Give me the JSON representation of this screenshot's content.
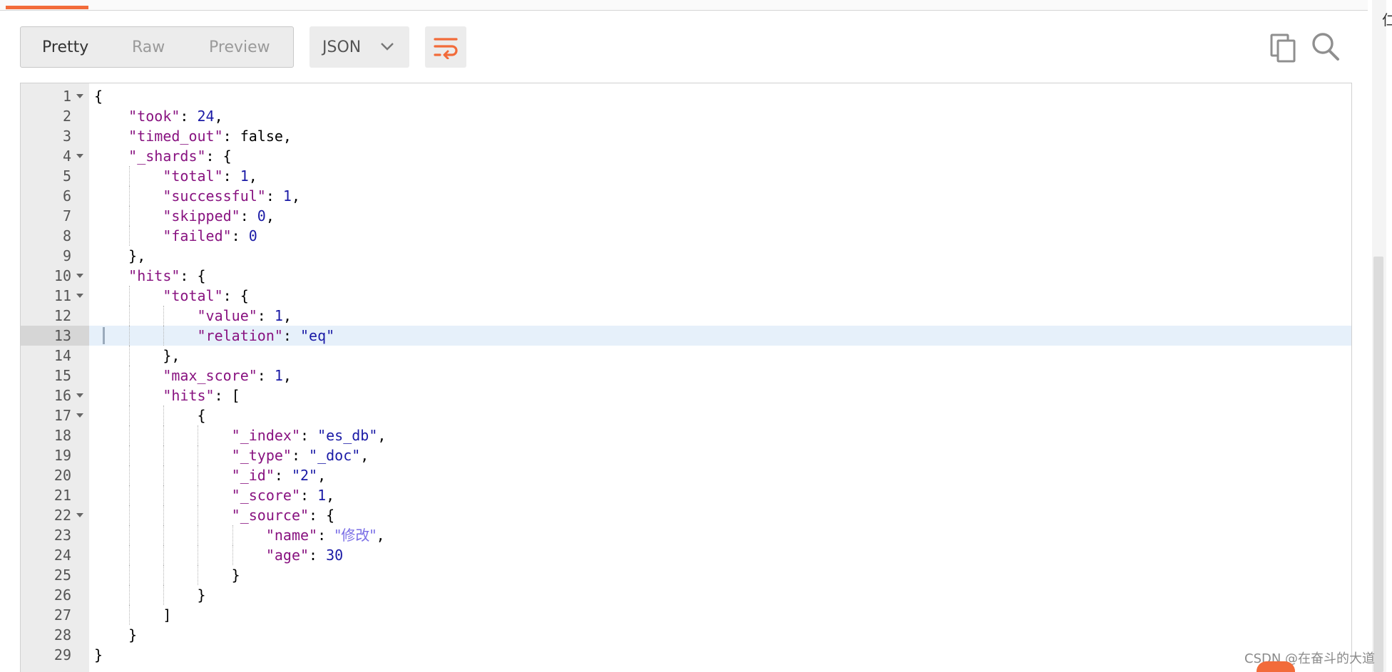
{
  "view_tabs": [
    "Pretty",
    "Raw",
    "Preview"
  ],
  "format": {
    "selected": "JSON"
  },
  "icons": {
    "wrap": "wrap-lines-icon",
    "copy": "copy-icon",
    "search": "search-icon",
    "dropdown": "chevron-down-icon",
    "fold": "fold-arrow-icon"
  },
  "colors": {
    "accent": "#f26b3a",
    "json_key": "#881280",
    "json_value": "#1a1aa6",
    "active_line": "#e6f0fa"
  },
  "editor": {
    "active_line": 13,
    "lines": [
      {
        "n": "1",
        "fold": true,
        "tokens": [
          [
            "p",
            "{"
          ]
        ]
      },
      {
        "n": "2",
        "tokens": [
          [
            "p",
            "    "
          ],
          [
            "k",
            "\"took\""
          ],
          [
            "p",
            ": "
          ],
          [
            "n",
            "24"
          ],
          [
            "p",
            ","
          ]
        ]
      },
      {
        "n": "3",
        "tokens": [
          [
            "p",
            "    "
          ],
          [
            "k",
            "\"timed_out\""
          ],
          [
            "p",
            ": false,"
          ]
        ]
      },
      {
        "n": "4",
        "fold": true,
        "tokens": [
          [
            "p",
            "    "
          ],
          [
            "k",
            "\"_shards\""
          ],
          [
            "p",
            ": {"
          ]
        ]
      },
      {
        "n": "5",
        "tokens": [
          [
            "p",
            "        "
          ],
          [
            "k",
            "\"total\""
          ],
          [
            "p",
            ": "
          ],
          [
            "n",
            "1"
          ],
          [
            "p",
            ","
          ]
        ]
      },
      {
        "n": "6",
        "tokens": [
          [
            "p",
            "        "
          ],
          [
            "k",
            "\"successful\""
          ],
          [
            "p",
            ": "
          ],
          [
            "n",
            "1"
          ],
          [
            "p",
            ","
          ]
        ]
      },
      {
        "n": "7",
        "tokens": [
          [
            "p",
            "        "
          ],
          [
            "k",
            "\"skipped\""
          ],
          [
            "p",
            ": "
          ],
          [
            "n",
            "0"
          ],
          [
            "p",
            ","
          ]
        ]
      },
      {
        "n": "8",
        "tokens": [
          [
            "p",
            "        "
          ],
          [
            "k",
            "\"failed\""
          ],
          [
            "p",
            ": "
          ],
          [
            "n",
            "0"
          ]
        ]
      },
      {
        "n": "9",
        "tokens": [
          [
            "p",
            "    },"
          ]
        ]
      },
      {
        "n": "10",
        "fold": true,
        "tokens": [
          [
            "p",
            "    "
          ],
          [
            "k",
            "\"hits\""
          ],
          [
            "p",
            ": {"
          ]
        ]
      },
      {
        "n": "11",
        "fold": true,
        "tokens": [
          [
            "p",
            "        "
          ],
          [
            "k",
            "\"total\""
          ],
          [
            "p",
            ": {"
          ]
        ]
      },
      {
        "n": "12",
        "tokens": [
          [
            "p",
            "            "
          ],
          [
            "k",
            "\"value\""
          ],
          [
            "p",
            ": "
          ],
          [
            "n",
            "1"
          ],
          [
            "p",
            ","
          ]
        ]
      },
      {
        "n": "13",
        "tokens": [
          [
            "p",
            "            "
          ],
          [
            "k",
            "\"relation\""
          ],
          [
            "p",
            ": "
          ],
          [
            "s",
            "\"eq\""
          ]
        ]
      },
      {
        "n": "14",
        "tokens": [
          [
            "p",
            "        },"
          ]
        ]
      },
      {
        "n": "15",
        "tokens": [
          [
            "p",
            "        "
          ],
          [
            "k",
            "\"max_score\""
          ],
          [
            "p",
            ": "
          ],
          [
            "n",
            "1"
          ],
          [
            "p",
            ","
          ]
        ]
      },
      {
        "n": "16",
        "fold": true,
        "tokens": [
          [
            "p",
            "        "
          ],
          [
            "k",
            "\"hits\""
          ],
          [
            "p",
            ": ["
          ]
        ]
      },
      {
        "n": "17",
        "fold": true,
        "tokens": [
          [
            "p",
            "            {"
          ]
        ]
      },
      {
        "n": "18",
        "tokens": [
          [
            "p",
            "                "
          ],
          [
            "k",
            "\"_index\""
          ],
          [
            "p",
            ": "
          ],
          [
            "s",
            "\"es_db\""
          ],
          [
            "p",
            ","
          ]
        ]
      },
      {
        "n": "19",
        "tokens": [
          [
            "p",
            "                "
          ],
          [
            "k",
            "\"_type\""
          ],
          [
            "p",
            ": "
          ],
          [
            "s",
            "\"_doc\""
          ],
          [
            "p",
            ","
          ]
        ]
      },
      {
        "n": "20",
        "tokens": [
          [
            "p",
            "                "
          ],
          [
            "k",
            "\"_id\""
          ],
          [
            "p",
            ": "
          ],
          [
            "s",
            "\"2\""
          ],
          [
            "p",
            ","
          ]
        ]
      },
      {
        "n": "21",
        "tokens": [
          [
            "p",
            "                "
          ],
          [
            "k",
            "\"_score\""
          ],
          [
            "p",
            ": "
          ],
          [
            "n",
            "1"
          ],
          [
            "p",
            ","
          ]
        ]
      },
      {
        "n": "22",
        "fold": true,
        "tokens": [
          [
            "p",
            "                "
          ],
          [
            "k",
            "\"_source\""
          ],
          [
            "p",
            ": {"
          ]
        ]
      },
      {
        "n": "23",
        "tokens": [
          [
            "p",
            "                    "
          ],
          [
            "k",
            "\"name\""
          ],
          [
            "p",
            ": "
          ],
          [
            "s cn",
            "\"修改\""
          ],
          [
            "p",
            ","
          ]
        ]
      },
      {
        "n": "24",
        "tokens": [
          [
            "p",
            "                    "
          ],
          [
            "k",
            "\"age\""
          ],
          [
            "p",
            ": "
          ],
          [
            "n",
            "30"
          ]
        ]
      },
      {
        "n": "25",
        "tokens": [
          [
            "p",
            "                }"
          ]
        ]
      },
      {
        "n": "26",
        "tokens": [
          [
            "p",
            "            }"
          ]
        ]
      },
      {
        "n": "27",
        "tokens": [
          [
            "p",
            "        ]"
          ]
        ]
      },
      {
        "n": "28",
        "tokens": [
          [
            "p",
            "    }"
          ]
        ]
      },
      {
        "n": "29",
        "tokens": [
          [
            "p",
            "}"
          ]
        ]
      }
    ]
  },
  "watermark": "CSDN @在奋斗的大道",
  "edge_text": "仁"
}
